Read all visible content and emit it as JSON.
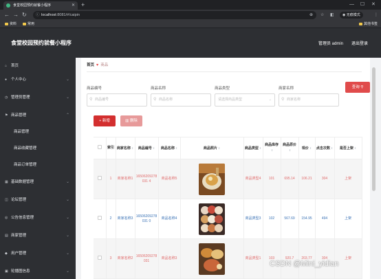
{
  "browser": {
    "tab_title": "食堂校园预约就餐小程序",
    "url_host": "localhost",
    "url_rest": ":8081/#/caipin",
    "incognito_label": "无痕模式",
    "bookmarks": [
      "资料",
      "常用"
    ],
    "bookmarks_right": "其他书签"
  },
  "header": {
    "title": "食堂校园预约就餐小程序",
    "admin": "管理员 admin",
    "logout": "退出登录"
  },
  "sidebar": {
    "items": [
      {
        "icon": "home-icon",
        "glyph": "⌂",
        "label": "首页",
        "expandable": false
      },
      {
        "icon": "user-icon",
        "glyph": "●",
        "label": "个人中心",
        "expandable": true
      },
      {
        "icon": "clock-icon",
        "glyph": "◷",
        "label": "管理员管理",
        "expandable": true
      },
      {
        "icon": "flag-icon",
        "glyph": "⚑",
        "label": "商品管理",
        "expandable": true
      },
      {
        "icon": "grid-icon",
        "glyph": "▦",
        "label": "基础数据管理",
        "expandable": true
      },
      {
        "icon": "chat-icon",
        "glyph": "◫",
        "label": "论坛管理",
        "expandable": true
      },
      {
        "icon": "notice-icon",
        "glyph": "◎",
        "label": "公告信息管理",
        "expandable": true
      },
      {
        "icon": "merchant-icon",
        "glyph": "▤",
        "label": "商家管理",
        "expandable": true
      },
      {
        "icon": "users-icon",
        "glyph": "◆",
        "label": "用户管理",
        "expandable": true
      },
      {
        "icon": "carousel-icon",
        "glyph": "▣",
        "label": "轮播图信息",
        "expandable": true
      }
    ],
    "subitems": [
      "商品管理",
      "商品收藏管理",
      "商品订单管理"
    ]
  },
  "breadcrumb": {
    "home": "首页",
    "current": "商品"
  },
  "filters": [
    {
      "label": "商品编号",
      "placeholder": "商品编号"
    },
    {
      "label": "商品名称",
      "placeholder": "商品名称"
    },
    {
      "label": "商品类型",
      "placeholder": "请选择商品类型"
    },
    {
      "label": "商家名称",
      "placeholder": "商家名称"
    }
  ],
  "buttons": {
    "search": "查询",
    "add": "新增",
    "delete": "删除"
  },
  "table": {
    "headers": [
      "索引",
      "商家名称",
      "商品编号",
      "商品名称",
      "商品照片",
      "商品类型",
      "商品库存",
      "商品原价",
      "现价",
      "点击次数",
      "是否上架"
    ],
    "rows": [
      {
        "index": "1",
        "merchant": "商家名称1",
        "code": "16506209278031 4",
        "name": "商品名称5",
        "type": "商品类型4",
        "stock": "101",
        "price": "695.14",
        "now": "106.21",
        "clicks": "304",
        "status": "上架",
        "style": "pink"
      },
      {
        "index": "2",
        "merchant": "商家名称3",
        "code": "16506209278031 0",
        "name": "商品名称4",
        "type": "商品类型3",
        "stock": "102",
        "price": "567.69",
        "now": "154.95",
        "clicks": "494",
        "status": "上架",
        "style": "blue"
      },
      {
        "index": "3",
        "merchant": "商家名称2",
        "code": "16506209278031",
        "name": "商品名称3",
        "type": "商品类型1",
        "stock": "103",
        "price": "920.7",
        "now": "203.77",
        "clicks": "304",
        "status": "上架",
        "style": "pink"
      }
    ]
  },
  "watermark": "CSDN @Mini_yidian",
  "colors": {
    "primary": "#d32f2f",
    "header_bg": "#2d2f33",
    "pink_text": "#e06b6b",
    "blue_text": "#3a72b5"
  }
}
